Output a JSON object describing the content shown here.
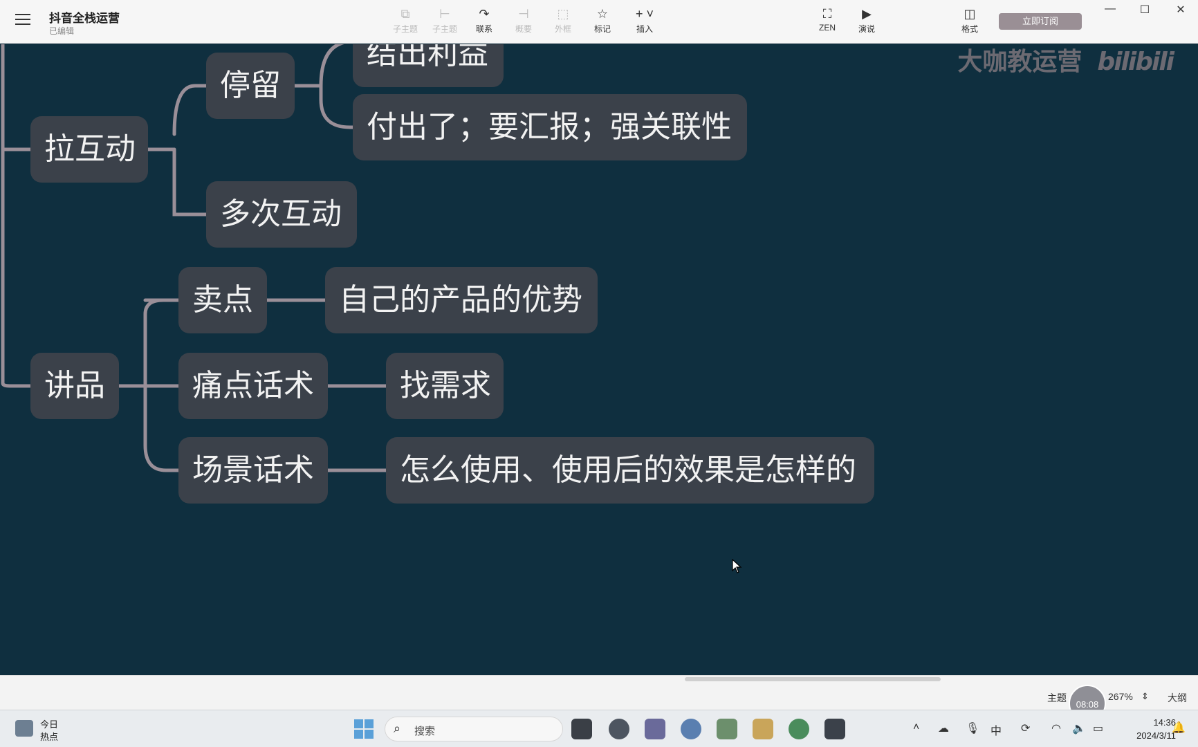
{
  "app": {
    "doc_title": "抖音全栈运营",
    "doc_status": "已编辑"
  },
  "toolbar": {
    "items": [
      {
        "label": "子主题",
        "icon": "subtopic-icon"
      },
      {
        "label": "子主题",
        "icon": "sibling-topic-icon"
      },
      {
        "label": "联系",
        "icon": "relationship-icon"
      },
      {
        "label": "概要",
        "icon": "summary-icon"
      },
      {
        "label": "外框",
        "icon": "boundary-icon"
      },
      {
        "label": "标记",
        "icon": "star-icon"
      },
      {
        "label": "插入",
        "icon": "plus-icon"
      }
    ],
    "zen_label": "ZEN",
    "present_label": "演说",
    "format_label": "格式",
    "subscribe_label": "立即订阅"
  },
  "mindmap": {
    "nodes": {
      "n_li_yi": "结出利益",
      "n_ting_liu": "停留",
      "n_fu_chu": "付出了；要汇报；强关联性",
      "n_la_hu_dong": "拉互动",
      "n_duo_ci": "多次互动",
      "n_mai_dian": "卖点",
      "n_you_shi": "自己的产品的优势",
      "n_jiang_pin": "讲品",
      "n_tong_dian": "痛点话术",
      "n_zhao_xu_qiu": "找需求",
      "n_chang_jing": "场景话术",
      "n_xiao_guo": "怎么使用、使用后的效果是怎样的"
    },
    "watermark_text": "大咖教运营",
    "watermark_brand": "bilibili"
  },
  "statusbar": {
    "theme_label": "主题",
    "timer": "08:08",
    "zoom": "267%",
    "outline_label": "大纲"
  },
  "taskbar": {
    "weather_line1": "今日",
    "weather_line2": "热点",
    "search_placeholder": "搜索",
    "ime": "中",
    "time": "14:36",
    "date": "2024/3/11"
  }
}
